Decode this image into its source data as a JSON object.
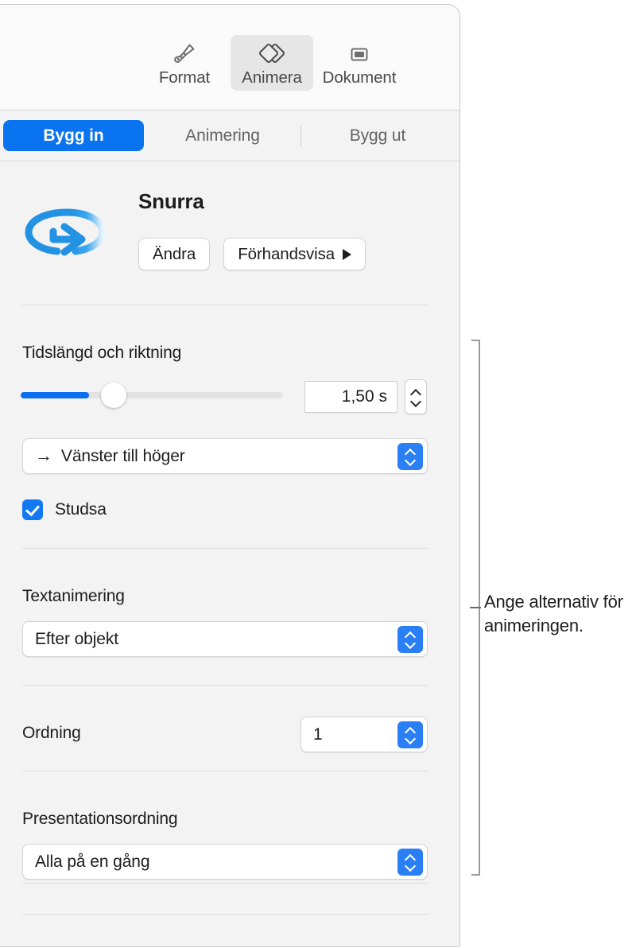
{
  "toolbar": {
    "items": [
      {
        "label": "Format",
        "icon": "paintbrush-icon",
        "selected": false
      },
      {
        "label": "Animera",
        "icon": "animate-diamonds-icon",
        "selected": true
      },
      {
        "label": "Dokument",
        "icon": "document-icon",
        "selected": false
      }
    ]
  },
  "tabs": [
    {
      "label": "Bygg in",
      "active": true
    },
    {
      "label": "Animering",
      "active": false
    },
    {
      "label": "Bygg ut",
      "active": false
    }
  ],
  "animation": {
    "name": "Snurra",
    "icon": "spin-arrow-icon",
    "change_button": "Ändra",
    "preview_button": "Förhandsvisa",
    "preview_icon": "play-triangle-icon"
  },
  "duration_section": {
    "label": "Tidslängd och riktning",
    "duration_value": "1,50 s",
    "slider_fill_percent": 26,
    "direction_value": "Vänster till höger",
    "direction_icon": "arrow-right-icon",
    "bounce_label": "Studsa",
    "bounce_checked": true
  },
  "text_animation_section": {
    "label": "Textanimering",
    "value": "Efter objekt"
  },
  "order_section": {
    "label": "Ordning",
    "value": "1"
  },
  "delivery_section": {
    "label": "Presentationsordning",
    "value": "Alla på en gång"
  },
  "callout": {
    "text": "Ange alternativ för animeringen."
  },
  "colors": {
    "accent": "#0a74f0",
    "popup_chevron": "#2b7ff5",
    "panel_bg": "#f3f3f3",
    "toolbar_bg": "#fafafa",
    "divider": "#dcdcdc",
    "callout_line": "#9a9a9a"
  }
}
